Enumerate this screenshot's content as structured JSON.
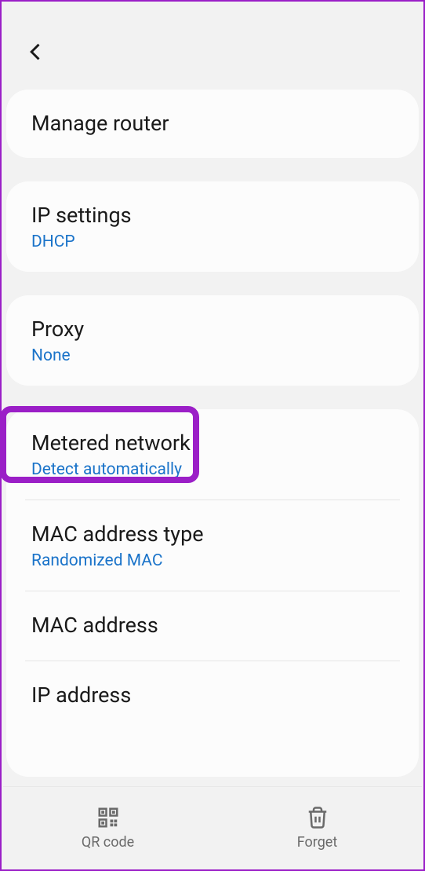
{
  "cards": {
    "manage_router": {
      "title": "Manage router"
    },
    "ip_settings": {
      "title": "IP settings",
      "value": "DHCP"
    },
    "proxy": {
      "title": "Proxy",
      "value": "None"
    }
  },
  "settings": {
    "metered_network": {
      "title": "Metered network",
      "value": "Detect automatically"
    },
    "mac_address_type": {
      "title": "MAC address type",
      "value": "Randomized MAC"
    },
    "mac_address": {
      "title": "MAC address"
    },
    "ip_address": {
      "title": "IP address"
    }
  },
  "bottom": {
    "qr_label": "QR code",
    "forget_label": "Forget"
  }
}
